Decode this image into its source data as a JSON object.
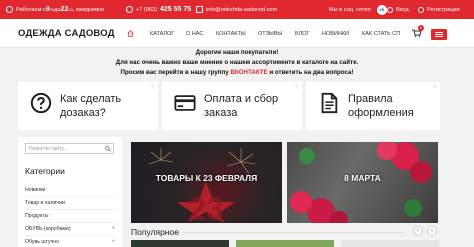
{
  "topbar": {
    "hours_prefix": "Работаем с ",
    "hours_from": "9",
    "hours_from_sub": "00",
    "hours_mid": " до ",
    "hours_to": "22",
    "hours_to_sub": "00",
    "hours_suffix": ", ежедневно",
    "phone_prefix": "+7 (963)",
    "phone_number": "425 55 75",
    "email": "info@odezhda-sadovod.com",
    "social_text": "Мы в соц. сетях:",
    "social_badge": "vk",
    "login": "Вход",
    "register": "Регистрация"
  },
  "header": {
    "logo": "ОДЕЖДА САДОВОД",
    "nav": [
      "КАТАЛОГ",
      "О НАС",
      "КОНТАКТЫ",
      "ОТЗЫВЫ",
      "БЛОГ",
      "НОВИНКИ",
      "КАК СТАТЬ СП"
    ],
    "cart_count": "0"
  },
  "announce": {
    "line1": "Дорогие наши покупатели!",
    "line2": "Для нас очень важно ваше мнение о нашем ассортименте в каталоге на сайте.",
    "line3_pre": "Просим вас перейти в нашу группу ",
    "line3_link": "ВКОНТАКТЕ",
    "line3_post": " и ответить на два вопроса!"
  },
  "features": [
    {
      "line1": "Как сделать",
      "line2": "дозаказ?",
      "icon": "question-circle-icon"
    },
    {
      "line1": "Оплата и сбор",
      "line2": "заказа",
      "icon": "credit-card-icon"
    },
    {
      "line1": "Правила",
      "line2": "оформления",
      "icon": "document-icon"
    }
  ],
  "sidebar": {
    "search_placeholder": "Поиск по сайту...",
    "title": "Категории",
    "items": [
      "Новинки",
      "Товар в наличии",
      "Продукты",
      "ОБУВЬ (коробами)",
      "Обувь штучно"
    ]
  },
  "banners": [
    "ТОВАРЫ К 23 ФЕВРАЛЯ",
    "8 МАРТА"
  ],
  "popular": {
    "title": "Популярное",
    "prev": "‹",
    "next": "›"
  },
  "colors": {
    "accent": "#e0282e",
    "vk": "#3b6bb0"
  }
}
